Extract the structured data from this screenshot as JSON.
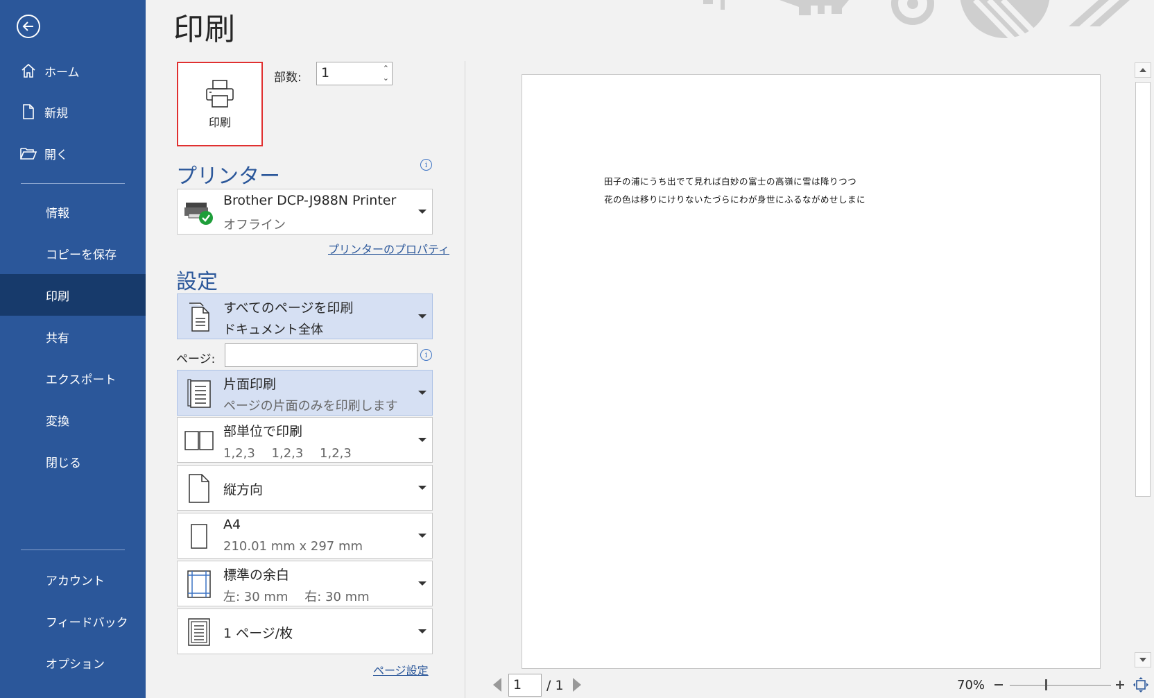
{
  "sidebar": {
    "items": [
      {
        "label": "ホーム",
        "icon": "home-icon"
      },
      {
        "label": "新規",
        "icon": "new-document-icon"
      },
      {
        "label": "開く",
        "icon": "open-folder-icon"
      },
      {
        "label": "情報"
      },
      {
        "label": "コピーを保存"
      },
      {
        "label": "印刷"
      },
      {
        "label": "共有"
      },
      {
        "label": "エクスポート"
      },
      {
        "label": "変換"
      },
      {
        "label": "閉じる"
      },
      {
        "label": "アカウント"
      },
      {
        "label": "フィードバック"
      },
      {
        "label": "オプション"
      }
    ],
    "active": "印刷"
  },
  "page_title": "印刷",
  "print_button": {
    "label": "印刷"
  },
  "copies": {
    "label": "部数:",
    "value": "1"
  },
  "printer": {
    "heading": "プリンター",
    "name": "Brother DCP-J988N Printer",
    "status": "オフライン",
    "properties_link": "プリンターのプロパティ"
  },
  "settings": {
    "heading": "設定",
    "pages_label": "ページ:",
    "pages_value": "",
    "dropdowns": [
      {
        "l1": "すべてのページを印刷",
        "l2": "ドキュメント全体"
      },
      {
        "l1": "片面印刷",
        "l2": "ページの片面のみを印刷します"
      },
      {
        "l1": "部単位で印刷",
        "l2": "1,2,3　 1,2,3　 1,2,3"
      },
      {
        "l1": "縦方向"
      },
      {
        "l1": "A4",
        "l2": "210.01 mm x 297 mm"
      },
      {
        "l1": "標準の余白",
        "l2": "左:  30 mm　 右:  30 mm"
      },
      {
        "l1": "1 ページ/枚"
      }
    ],
    "page_setup_link": "ページ設定"
  },
  "preview": {
    "lines": [
      "田子の浦にうち出でて見れば白妙の富士の高嶺に雪は降りつつ",
      "花の色は移りにけりないたづらにわが身世にふるながめせしまに"
    ]
  },
  "navigation": {
    "current_page": "1",
    "total": "/ 1"
  },
  "zoom": {
    "value": "70%"
  },
  "colors": {
    "sidebar": "#2b579a",
    "active_item": "#173a6b",
    "accent": "#2b579a",
    "highlight": "#d6e0f3",
    "print_button_border": "#e03030"
  }
}
